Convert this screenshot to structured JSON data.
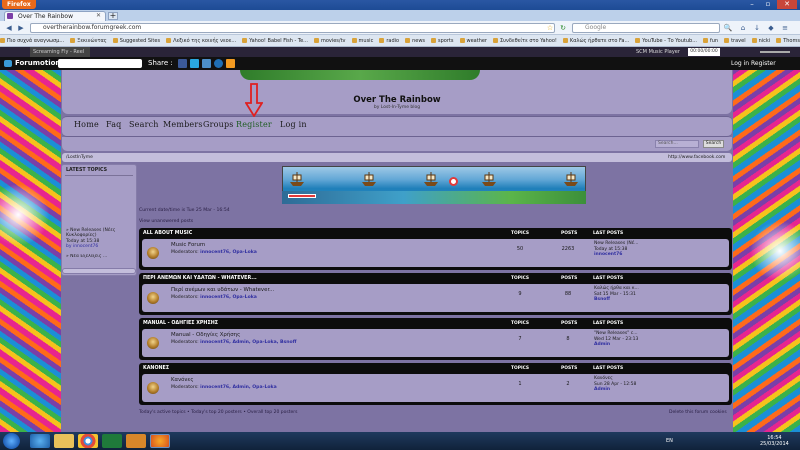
{
  "browser": {
    "app_button": "Firefox",
    "tab_title": "Over The Rainbow",
    "url": "overtherainbow.forumgreek.com",
    "search_placeholder": "Google",
    "bookmarks": [
      "Πιο συχνά αναγνωσμ...",
      "Ξεκινώντας",
      "Suggested Sites",
      "Λεξικό της κοινής νεοε...",
      "Yahoo! Babel Fish - Te...",
      "movies/tv",
      "music",
      "radio",
      "news",
      "sports",
      "weather",
      "Συνδεθείτε στο Yahoo!",
      "Καλώς ήρθατε στο Fa...",
      "YouTube - Το Youtub...",
      "fun",
      "travel",
      "nicki",
      "Thomson Gateway - H..."
    ],
    "radio_label": "Screaming Fly - Reel",
    "player_label": "SCM Music Player",
    "player_time": "00:00/00:00"
  },
  "forumotion": {
    "logo": "Forumotion",
    "share": "Share :",
    "login": "Log in",
    "register": "Register"
  },
  "site": {
    "title": "Over The Rainbow",
    "subtitle": "by Lost-In-Tyme blog",
    "menu": [
      "Home",
      "Faq",
      "Search",
      "Members",
      "Groups",
      "Register",
      "Log in"
    ],
    "search_placeholder": "Search...",
    "search_button": "Search",
    "link_left": "/LostInTyme",
    "link_right": "http://www.facebook.com",
    "datetime": "Current date/time is Tue 25 Mar - 16:54",
    "unanswered": "View unanswered posts",
    "footer_left": "Today's active topics  •  Today's top 20 posters  •  Overall top 20 posters",
    "footer_right": "Delete this forum cookies"
  },
  "sidebar": {
    "title": "LATEST TOPICS",
    "item_title": "» New Releases (Νέες Κυκλοφορίες)",
    "item_date": "Today at 15:38",
    "item_by": "by innocent76",
    "item_next": "» Νέα Εξελίξεις ..."
  },
  "columns": {
    "topics": "TOPICS",
    "posts": "POSTS",
    "last": "LAST POSTS"
  },
  "categories": [
    {
      "name": "ALL ABOUT MUSIC",
      "forum": "Music Forum",
      "mods": "innocent76, Opa-Loka",
      "topics": "50",
      "posts": "2263",
      "last_title": "New Releases (Νέ...",
      "last_date": "Today at 15:38",
      "last_by": "innocent76"
    },
    {
      "name": "ΠΕΡΙ ΑΝΕΜΩΝ ΚΑΙ ΥΔΑΤΩΝ - WHATEVER...",
      "forum": "Περί ανέμων και υδάτων - Whatever...",
      "mods": "innocent76, Opa-Loka",
      "topics": "9",
      "posts": "88",
      "last_title": "Καλώς ήρθα και κ...",
      "last_date": "Sat 15 Mar - 15:31",
      "last_by": "Bsnoff"
    },
    {
      "name": "MANUAL - ΟΔΗΓΙΕΣ ΧΡΗΣΗΣ",
      "forum": "Manual - Οδηγίες Χρήσης",
      "mods": "innocent76, Admin, Opa-Loka, Bsnoff",
      "topics": "7",
      "posts": "8",
      "last_title": "\"New Releases\" c...",
      "last_date": "Wed 12 Mar - 23:13",
      "last_by": "Admin"
    },
    {
      "name": "ΚΑΝΟΝΕΣ",
      "forum": "Κανόνες",
      "mods": "innocent76, Admin, Opa-Loka",
      "topics": "1",
      "posts": "2",
      "last_title": "Κανόνες",
      "last_date": "Sun 28 Apr - 12:58",
      "last_by": "Admin"
    }
  ],
  "mods_label": "Moderators:",
  "taskbar": {
    "lang": "EN",
    "time": "16:54",
    "date": "25/03/2014"
  },
  "colors": {
    "accent": "#a69dc6",
    "header_black": "#0c0c0c",
    "arrow": "#e02020",
    "link": "#2f2ea0"
  }
}
